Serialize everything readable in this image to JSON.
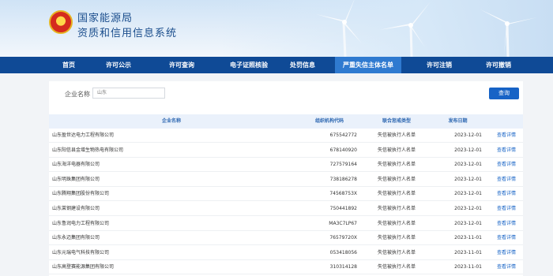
{
  "header": {
    "title_line1": "国家能源局",
    "title_line2": "资质和信用信息系统",
    "emblem_glyph": "★"
  },
  "nav": {
    "items": [
      {
        "label": "首页",
        "active": false
      },
      {
        "label": "许可公示",
        "active": false
      },
      {
        "label": "许可查询",
        "active": false
      },
      {
        "label": "电子证照核验",
        "active": false
      },
      {
        "label": "处罚信息",
        "active": false
      },
      {
        "label": "严重失信主体名单",
        "active": true
      },
      {
        "label": "许可注销",
        "active": false
      },
      {
        "label": "许可撤销",
        "active": false
      }
    ]
  },
  "search": {
    "label": "企业名称",
    "value": "山东",
    "button_label": "查询"
  },
  "table": {
    "headers": [
      "企业名称",
      "组织机构代码",
      "联合惩戒类型",
      "发布日期"
    ],
    "rows": [
      {
        "name": "山东盈世达电力工程有限公司",
        "code": "675542772",
        "type": "失信被执行人名单",
        "date": "2023-12-01",
        "action": "查看详情"
      },
      {
        "name": "山东阳信县金增生物热电有限公司",
        "code": "678140920",
        "type": "失信被执行人名单",
        "date": "2023-12-01",
        "action": "查看详情"
      },
      {
        "name": "山东海洋电器有限公司",
        "code": "727579164",
        "type": "失信被执行人名单",
        "date": "2023-12-01",
        "action": "查看详情"
      },
      {
        "name": "山东明珠集团有限公司",
        "code": "738186278",
        "type": "失信被执行人名单",
        "date": "2023-12-01",
        "action": "查看详情"
      },
      {
        "name": "山东腾翔集团股份有限公司",
        "code": "74568753X",
        "type": "失信被执行人名单",
        "date": "2023-12-01",
        "action": "查看详情"
      },
      {
        "name": "山东莱钢建设有限公司",
        "code": "750441892",
        "type": "失信被执行人名单",
        "date": "2023-12-01",
        "action": "查看详情"
      },
      {
        "name": "山东鲁润电力工程有限公司",
        "code": "MA3C7LP67",
        "type": "失信被执行人名单",
        "date": "2023-12-01",
        "action": "查看详情"
      },
      {
        "name": "山东永迈集团有限公司",
        "code": "76579720X",
        "type": "失信被执行人名单",
        "date": "2023-11-01",
        "action": "查看详情"
      },
      {
        "name": "山东元瑞电气科技有限公司",
        "code": "053418056",
        "type": "失信被执行人名单",
        "date": "2023-11-01",
        "action": "查看详情"
      },
      {
        "name": "山东高登赛能源集团有限公司",
        "code": "310314128",
        "type": "失信被执行人名单",
        "date": "2023-11-01",
        "action": "查看详情"
      }
    ]
  },
  "colors": {
    "nav_bg": "#0f4a96",
    "nav_active": "#2f7ad0",
    "link": "#1763c6",
    "header_text": "#1a4d8c"
  }
}
